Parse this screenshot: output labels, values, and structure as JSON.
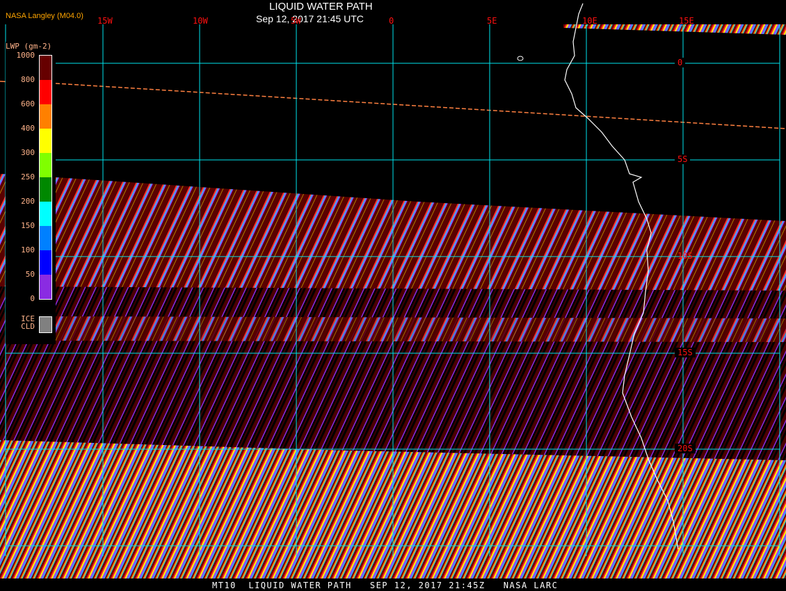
{
  "header": {
    "title": "LIQUID WATER PATH",
    "datetime": "Sep 12, 2017 21:45 UTC",
    "organization": "NASA Langley (M04.0)"
  },
  "map": {
    "longitude_labels": [
      "15W",
      "10W",
      "5W",
      "0",
      "5E",
      "10E",
      "15E"
    ],
    "latitude_labels": [
      "0",
      "5S",
      "10S",
      "15S",
      "20S"
    ],
    "grid_color": "#00e5ee",
    "label_color": "#ff1010",
    "coastline_color": "#ffffff"
  },
  "legend": {
    "title": "LWP (gm-2)",
    "ticks": [
      "1000",
      "800",
      "600",
      "400",
      "300",
      "250",
      "200",
      "150",
      "100",
      "50",
      "0"
    ],
    "colors": [
      "#660000",
      "#ff0000",
      "#ff8000",
      "#ffff00",
      "#80ff00",
      "#008800",
      "#00ffff",
      "#0080ff",
      "#0000ff",
      "#8a2be2"
    ],
    "ice_label_1": "ICE",
    "ice_label_2": "CLD",
    "ice_color": "#808080"
  },
  "footer": {
    "caption": "MT10  LIQUID WATER PATH   SEP 12, 2017 21:45Z   NASA LARC"
  }
}
